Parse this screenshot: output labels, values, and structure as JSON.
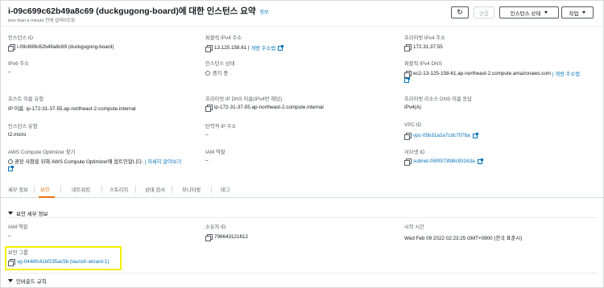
{
  "header": {
    "title": "i-09c699c62b49a8c69 (duckgugong-board)에 대한 인스턴스 요약",
    "info_link": "정보",
    "subtitle": "less than a minute 전에 업데이트됨",
    "refresh_icon": "↻",
    "connect_label": "연결",
    "instance_state_label": "인스턴스 상태",
    "actions_label": "작업"
  },
  "details": {
    "instance_id": {
      "label": "인스턴스 ID",
      "value": "i-09c699c62b49a8c69 (duckgugong-board)"
    },
    "public_ipv4": {
      "label": "퍼블릭 IPv4 주소",
      "value": "13.125.158.61",
      "link": "개방 주소법"
    },
    "private_ipv4": {
      "label": "프라이빗 IPv4 주소",
      "value": "172.31.37.55"
    },
    "ipv6": {
      "label": "IPv6 주소",
      "value": "–"
    },
    "instance_state": {
      "label": "인스턴스 상태",
      "value": "중지 중"
    },
    "public_dns": {
      "label": "퍼블릭 IPv4 DNS",
      "value": "ec2-13-125-158-61.ap-northeast-2.compute.amazonaws.com",
      "link": "| 개방 주소법"
    },
    "hostname_type": {
      "label": "호스트 이름 유형",
      "value": "IP 이름: ip-172-31-37-55.ap-northeast-2.compute.internal"
    },
    "private_dns_ipv4": {
      "label": "프라이빗 IP DNS 이름(IPv4만 해당)",
      "value": "ip-172-31-37-55.ap-northeast-2.compute.internal"
    },
    "private_resource_dns": {
      "label": "프라이빗 리소스 DNS 이름 응답",
      "value": "IPv4(A)"
    },
    "instance_type": {
      "label": "인스턴스 유형",
      "value": "t2.micro"
    },
    "elastic_ip": {
      "label": "탄력적 IP 주소",
      "value": "–"
    },
    "vpc_id": {
      "label": "VPC ID",
      "value": "vpc-05b31a2a7cdc707ba"
    },
    "optimizer": {
      "label": "AWS Compute Optimizer 찾기",
      "value": "권장 사항을 위해 AWS Compute Optimizer에 옵트인합니다.",
      "link": "| 자세히 알아보기"
    },
    "iam_role": {
      "label": "IAM 역할",
      "value": "–"
    },
    "subnet_id": {
      "label": "서브넷 ID",
      "value": "subnet-05f0973fd8c93163a"
    }
  },
  "tabs": [
    "세부 정보",
    "보안",
    "네트워킹",
    "스토리지",
    "상태 검사",
    "모니터링",
    "태그"
  ],
  "security": {
    "section_title": "보안 세부 정보",
    "iam_role_label": "IAM 역할",
    "iam_role_value": "–",
    "owner_id_label": "소유자 ID",
    "owner_id_value": "796643121612",
    "launch_time_label": "시작 시간",
    "launch_time_value": "Wed Feb 09 2022 02:23:25 GMT+0900 (한국 표준시)",
    "security_groups_label": "보안 그룹",
    "security_group_value": "sg-0448fc41bf235ac5b (launch-wizard-1)",
    "inbound_rules_title": "인바운드 규칙"
  },
  "colors": {
    "accent": "#ec7211",
    "link": "#0073bb",
    "highlight": "#f5f000"
  }
}
